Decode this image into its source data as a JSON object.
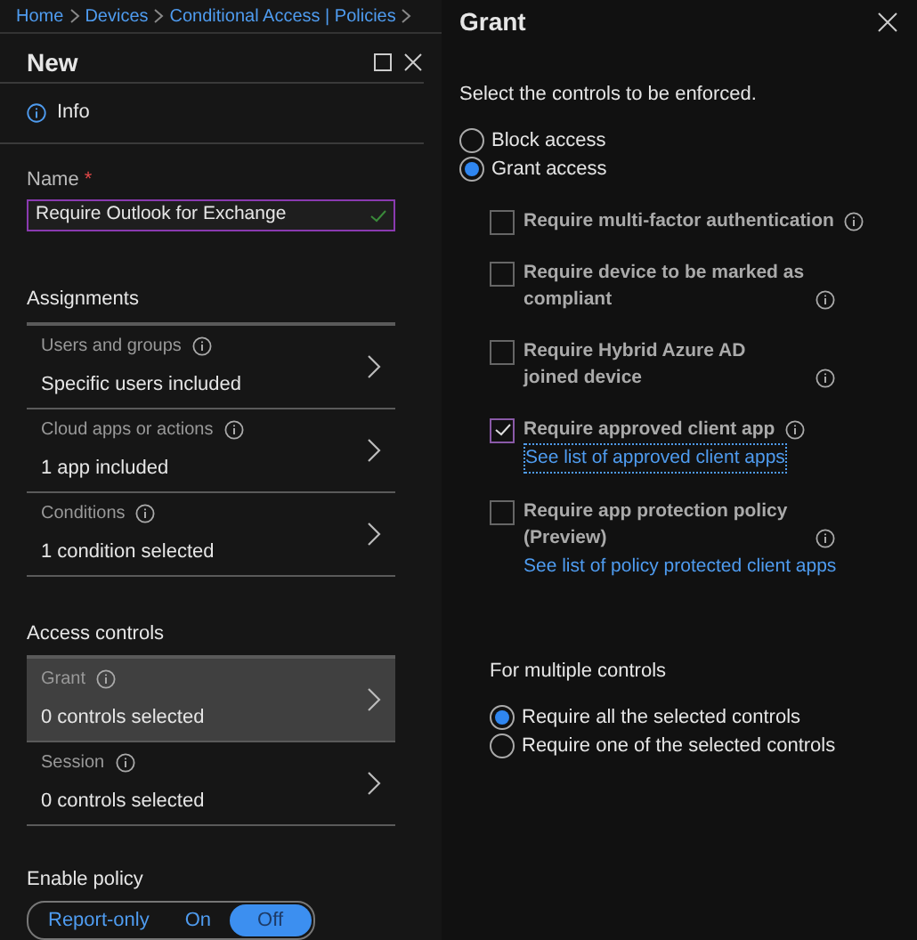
{
  "breadcrumb": [
    {
      "label": "Home"
    },
    {
      "label": "Devices"
    },
    {
      "label": "Conditional Access | Policies"
    }
  ],
  "blade": {
    "title": "New"
  },
  "info": {
    "label": "Info"
  },
  "name_field": {
    "label": "Name",
    "required_mark": "*",
    "value": "Require Outlook for Exchange",
    "valid": true
  },
  "sections": [
    {
      "title": "Assignments",
      "items": [
        {
          "label": "Users and groups",
          "value": "Specific users included",
          "selected": false
        },
        {
          "label": "Cloud apps or actions",
          "value": "1 app included",
          "selected": false
        },
        {
          "label": "Conditions",
          "value": "1 condition selected",
          "selected": false
        }
      ]
    },
    {
      "title": "Access controls",
      "items": [
        {
          "label": "Grant",
          "value": "0 controls selected",
          "selected": true
        },
        {
          "label": "Session",
          "value": "0 controls selected",
          "selected": false
        }
      ]
    }
  ],
  "enable_policy": {
    "label": "Enable policy",
    "options": [
      {
        "label": "Report-only",
        "selected": false
      },
      {
        "label": "On",
        "selected": false
      },
      {
        "label": "Off",
        "selected": true
      }
    ]
  },
  "grant": {
    "title": "Grant",
    "instruction": "Select the controls to be enforced.",
    "access": [
      {
        "label": "Block access",
        "selected": false
      },
      {
        "label": "Grant access",
        "selected": true
      }
    ],
    "controls": [
      {
        "label": "Require multi-factor authentication",
        "checked": false
      },
      {
        "label": "Require device to be marked as compliant",
        "checked": false
      },
      {
        "label": "Require Hybrid Azure AD joined device",
        "checked": false
      },
      {
        "label": "Require approved client app",
        "checked": true,
        "link": "See list of approved client apps",
        "link_focused": true
      },
      {
        "label": "Require app protection policy (Preview)",
        "checked": false,
        "link": "See list of policy protected client apps",
        "link_focused": false
      }
    ],
    "multiple": {
      "title": "For multiple controls",
      "options": [
        {
          "label": "Require all the selected controls",
          "selected": true
        },
        {
          "label": "Require one of the selected controls",
          "selected": false
        }
      ]
    }
  }
}
